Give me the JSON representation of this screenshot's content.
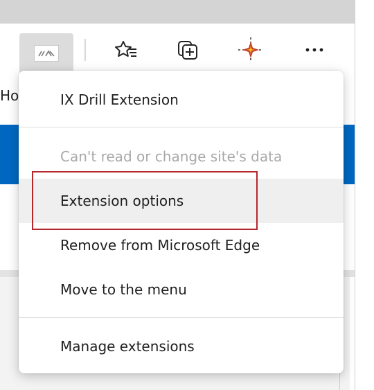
{
  "toolbar": {
    "extension_button_icon": "ix-drill-logo-icon",
    "icons": [
      "favorites-star-icon",
      "collections-icon",
      "compass-crosshair-icon",
      "more-dots-icon"
    ],
    "more_label": "···"
  },
  "page": {
    "fragment": "Ho"
  },
  "menu": {
    "items": [
      {
        "label": "IX Drill Extension",
        "enabled": true
      },
      {
        "label": "Can't read or change site's data",
        "enabled": false
      },
      {
        "label": "Extension options",
        "enabled": true,
        "highlighted": true
      },
      {
        "label": "Remove from Microsoft Edge",
        "enabled": true
      },
      {
        "label": "Move to the menu",
        "enabled": true
      },
      {
        "label": "Manage extensions",
        "enabled": true
      }
    ]
  },
  "colors": {
    "accent_blue": "#0067c0",
    "annotation_red": "#b5262b",
    "disabled_text": "#a8a8a8",
    "hover_bg": "#efefef"
  }
}
